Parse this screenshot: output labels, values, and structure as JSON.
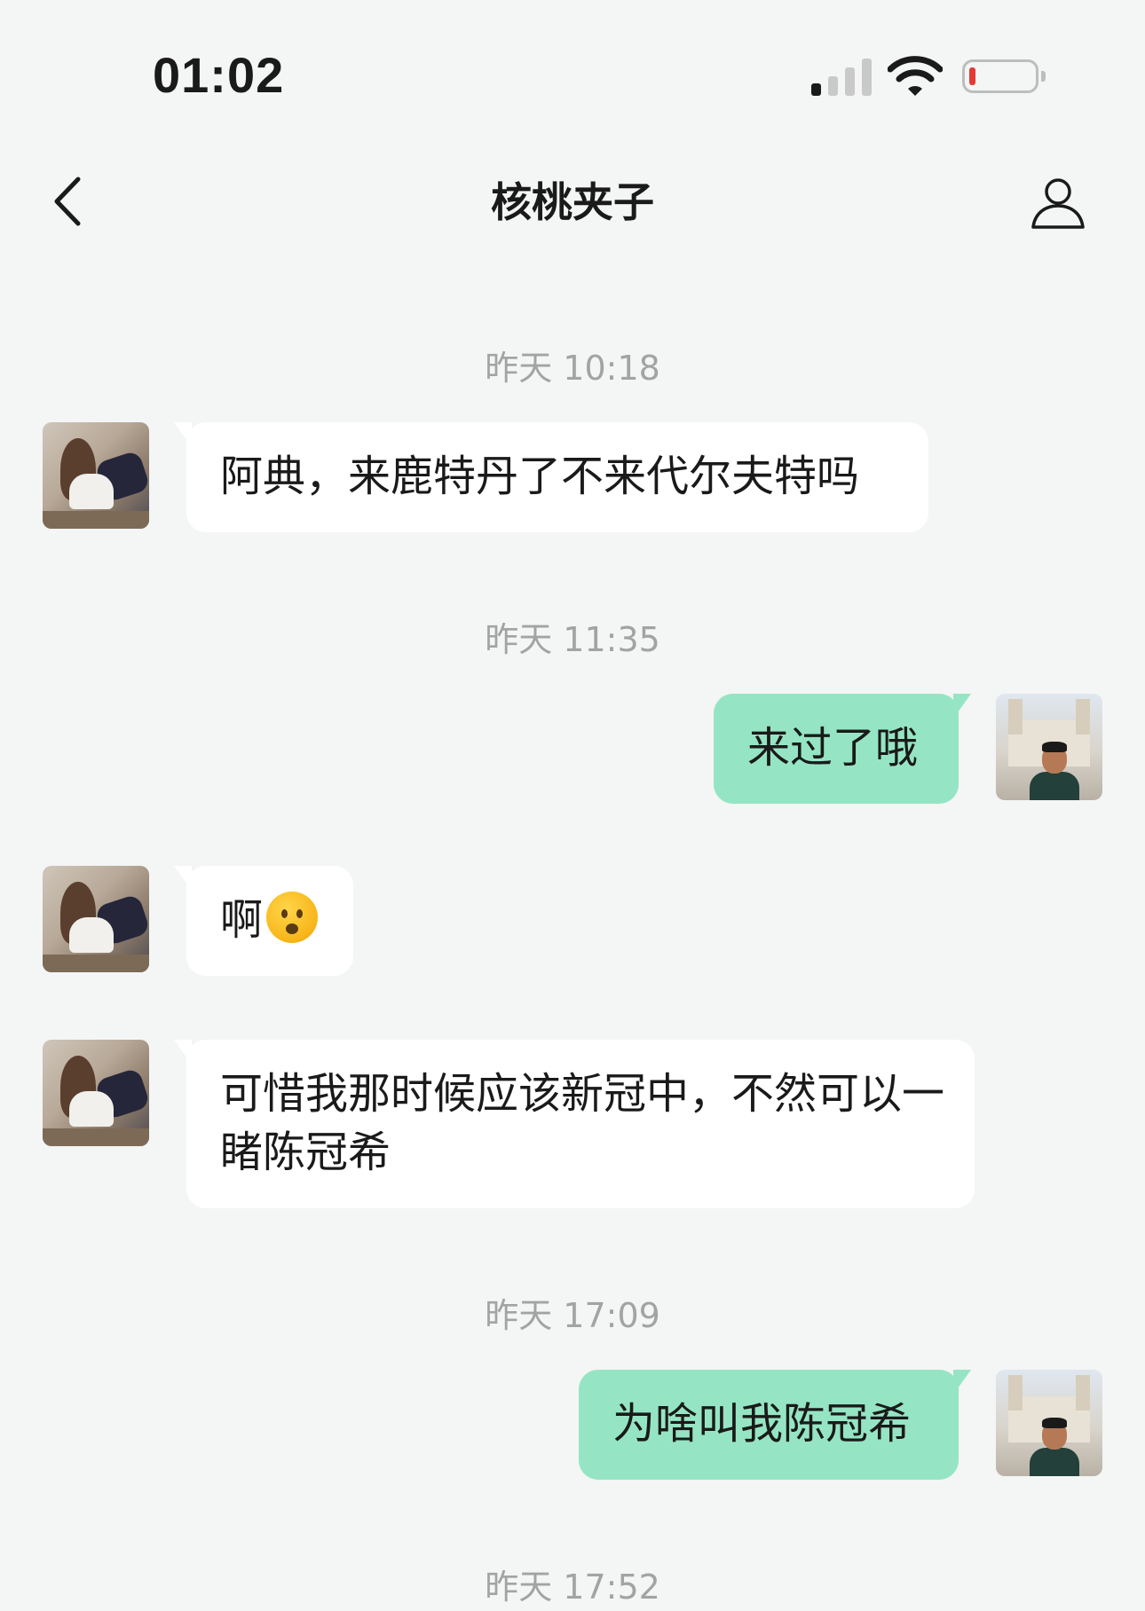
{
  "status_bar": {
    "time": "01:02",
    "signal_bars_active": 1,
    "battery_level": "low",
    "battery_color": "#e53935"
  },
  "header": {
    "title": "核桃夹子",
    "back_icon": "chevron-left-icon",
    "profile_icon": "person-icon"
  },
  "colors": {
    "background": "#f4f5f5",
    "incoming_bubble": "#ffffff",
    "outgoing_bubble": "#95e5c4",
    "timestamp_text": "#a3a3a3"
  },
  "timestamps": [
    "昨天 10:18",
    "昨天 11:35",
    "昨天 17:09",
    "昨天 17:52"
  ],
  "messages": [
    {
      "sender": "contact",
      "text": "阿典，来鹿特丹了不来代尔夫特吗"
    },
    {
      "sender": "me",
      "text": "来过了哦"
    },
    {
      "sender": "contact",
      "text": "啊",
      "emoji": "anguished-face-emoji"
    },
    {
      "sender": "contact",
      "text": "可惜我那时候应该新冠中，不然可以一睹陈冠希"
    },
    {
      "sender": "me",
      "text": "为啥叫我陈冠希"
    }
  ]
}
